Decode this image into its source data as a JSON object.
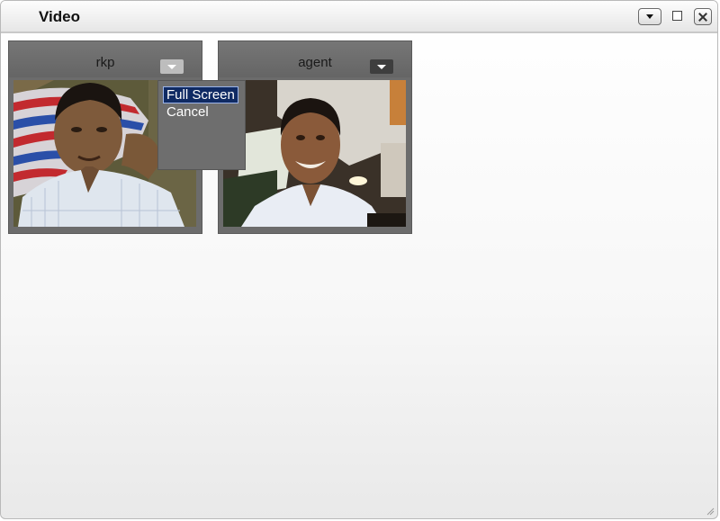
{
  "window": {
    "title": "Video"
  },
  "participants": [
    {
      "name": "rkp"
    },
    {
      "name": "agent"
    }
  ],
  "context_menu": {
    "items": [
      {
        "label": "Full Screen",
        "selected": true
      },
      {
        "label": "Cancel",
        "selected": false
      }
    ]
  },
  "icons": [
    "dropdown-icon",
    "maximize-icon",
    "close-icon",
    "resize-grip-icon"
  ],
  "colors": {
    "panel": "#6c6c6c",
    "menu_selected": "#0f2a63"
  }
}
